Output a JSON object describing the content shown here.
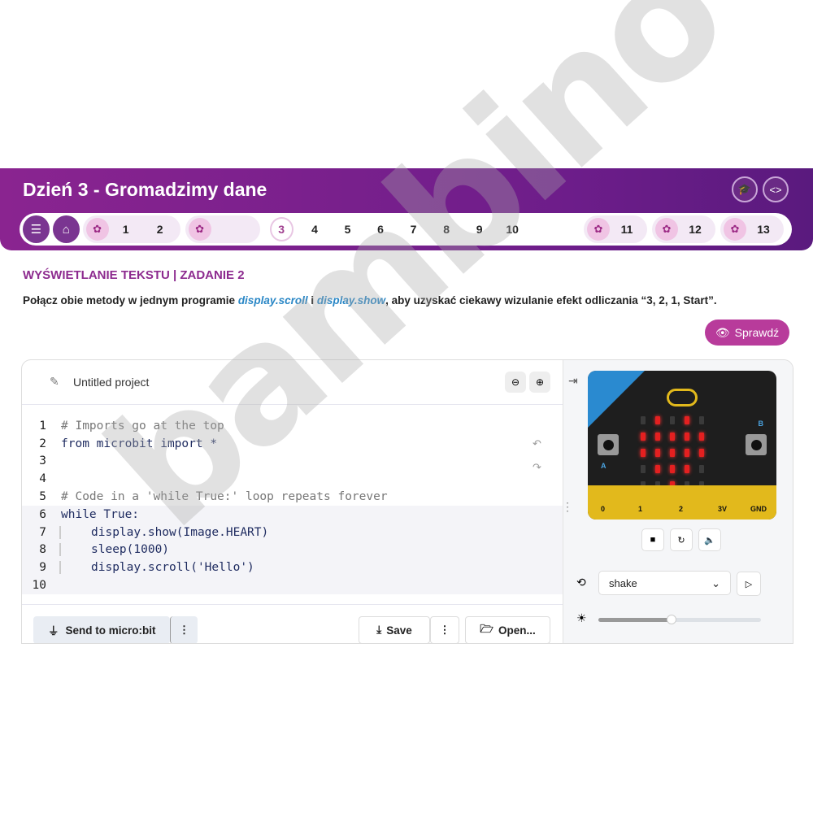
{
  "header": {
    "title": "Dzień 3 - Gromadzimy dane",
    "nav": {
      "group1": [
        "1",
        "2"
      ],
      "current": "3",
      "middle": [
        "4",
        "5",
        "6",
        "7",
        "8",
        "9",
        "10"
      ],
      "tail": [
        "11",
        "12",
        "13"
      ]
    }
  },
  "task": {
    "title": "WYŚWIETLANIE TEKSTU | ZADANIE 2",
    "desc_pre": "Połącz obie metody w jednym programie ",
    "m1": "display.scroll",
    "mid": " i ",
    "m2": "display.show",
    "desc_post": ", aby uzyskać ciekawy wizulanie efekt odliczania “3, 2, 1, Start”.",
    "check": "Sprawdź"
  },
  "editor": {
    "project": "Untitled project",
    "code": [
      {
        "n": "1",
        "t": "# Imports go at the top"
      },
      {
        "n": "2",
        "t": "from microbit import *"
      },
      {
        "n": "3",
        "t": ""
      },
      {
        "n": "4",
        "t": ""
      },
      {
        "n": "5",
        "t": "# Code in a 'while True:' loop repeats forever"
      },
      {
        "n": "6",
        "t": "while True:"
      },
      {
        "n": "7",
        "t": "display.show(Image.HEART)"
      },
      {
        "n": "8",
        "t": "sleep(1000)"
      },
      {
        "n": "9",
        "t": "display.scroll('Hello')"
      },
      {
        "n": "10",
        "t": ""
      }
    ],
    "send": "Send to micro:bit",
    "save": "Save",
    "open": "Open..."
  },
  "sim": {
    "leds": [
      0,
      1,
      0,
      1,
      0,
      1,
      1,
      1,
      1,
      1,
      1,
      1,
      1,
      1,
      1,
      0,
      1,
      1,
      1,
      0,
      0,
      0,
      1,
      0,
      0
    ],
    "pins": [
      "0",
      "1",
      "2",
      "3V",
      "GND"
    ],
    "gesture": "shake",
    "brightness": 0.45,
    "btnA": "A",
    "btnB": "B"
  },
  "colors": {
    "purple": "#7a2590",
    "accent": "#b83b9b",
    "link": "#2a87c6"
  },
  "watermark": "mały bambino"
}
